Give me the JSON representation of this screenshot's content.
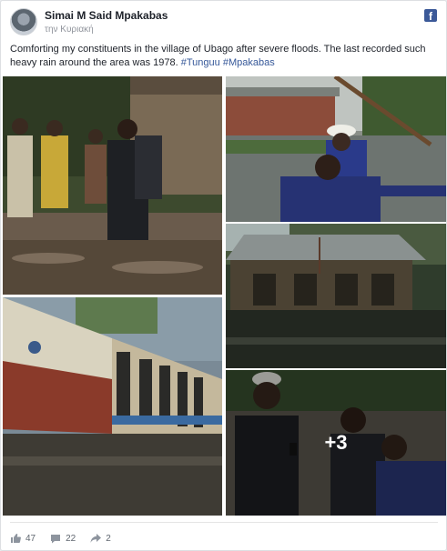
{
  "post": {
    "author": "Simai M Said Mpakabas",
    "timestamp": "την Κυριακή",
    "text": "Comforting my constituents in the village of Ubago after severe floods. The last recorded such heavy rain around the area was 1978.",
    "hashtags": [
      "#Tunguu",
      "#Mpakabas"
    ]
  },
  "platform_icon": "facebook-icon",
  "gallery": {
    "more_count_label": "+3"
  },
  "stats": {
    "likes": "47",
    "comments": "22",
    "shares": "2"
  },
  "colors": {
    "link": "#365899",
    "brand": "#3b5998",
    "text": "#1d2129",
    "muted": "#90949c"
  }
}
